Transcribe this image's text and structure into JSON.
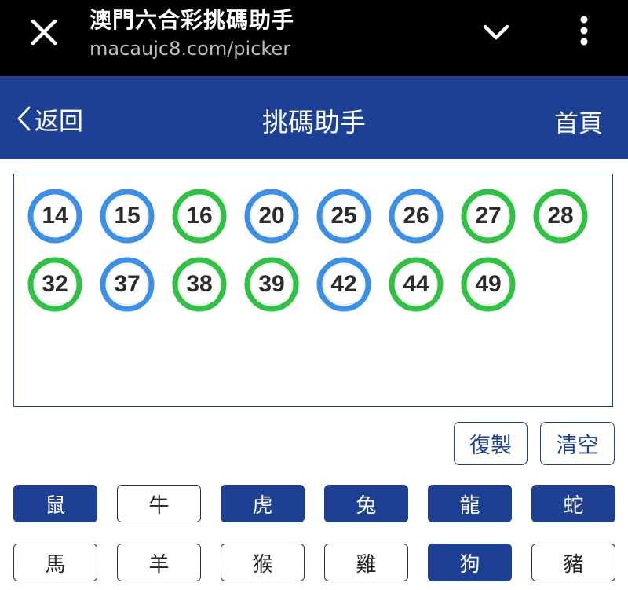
{
  "browser": {
    "title": "澳門六合彩挑碼助手",
    "url": "macaujc8.com/picker"
  },
  "header": {
    "back_label": "返回",
    "title": "挑碼助手",
    "home_label": "首頁"
  },
  "colors": {
    "brand": "#1d3f94",
    "ball_blue": "#3b8fe6",
    "ball_green": "#2fc142"
  },
  "balls": [
    {
      "number": "14",
      "color": "blue"
    },
    {
      "number": "15",
      "color": "blue"
    },
    {
      "number": "16",
      "color": "green"
    },
    {
      "number": "20",
      "color": "blue"
    },
    {
      "number": "25",
      "color": "blue"
    },
    {
      "number": "26",
      "color": "blue"
    },
    {
      "number": "27",
      "color": "green"
    },
    {
      "number": "28",
      "color": "green"
    },
    {
      "number": "32",
      "color": "green"
    },
    {
      "number": "37",
      "color": "blue"
    },
    {
      "number": "38",
      "color": "green"
    },
    {
      "number": "39",
      "color": "green"
    },
    {
      "number": "42",
      "color": "blue"
    },
    {
      "number": "44",
      "color": "green"
    },
    {
      "number": "49",
      "color": "green"
    }
  ],
  "actions": {
    "copy_label": "復製",
    "clear_label": "清空"
  },
  "zodiac": [
    {
      "label": "鼠",
      "selected": true
    },
    {
      "label": "牛",
      "selected": false
    },
    {
      "label": "虎",
      "selected": true
    },
    {
      "label": "兔",
      "selected": true
    },
    {
      "label": "龍",
      "selected": true
    },
    {
      "label": "蛇",
      "selected": true
    },
    {
      "label": "馬",
      "selected": false
    },
    {
      "label": "羊",
      "selected": false
    },
    {
      "label": "猴",
      "selected": false
    },
    {
      "label": "雞",
      "selected": false
    },
    {
      "label": "狗",
      "selected": true
    },
    {
      "label": "豬",
      "selected": false
    }
  ]
}
